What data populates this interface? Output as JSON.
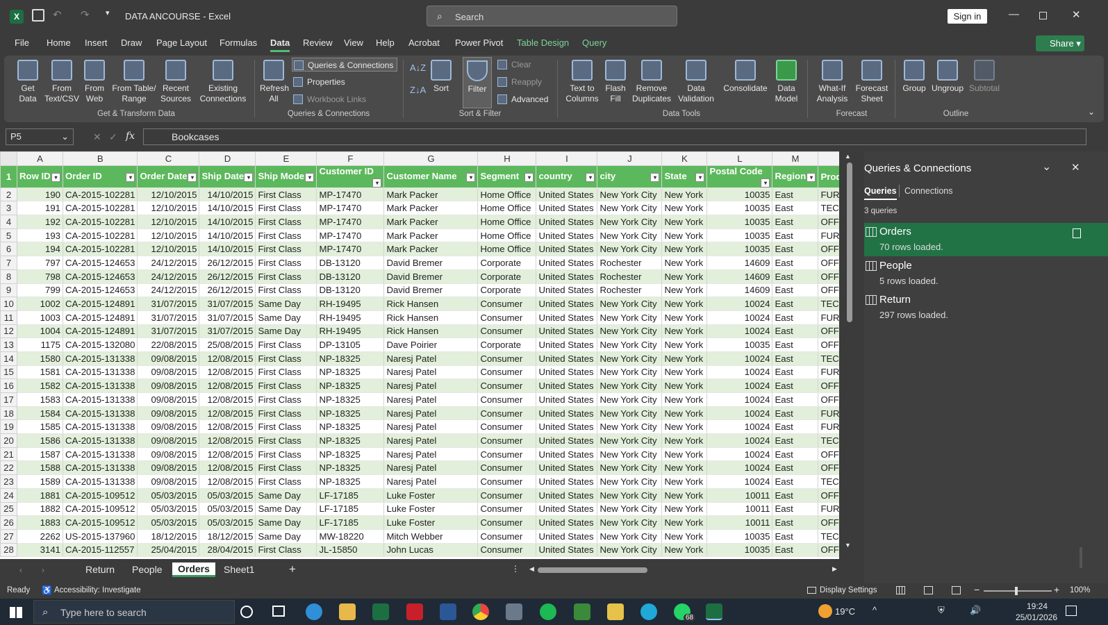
{
  "app": {
    "file_title": "DATA ANCOURSE",
    "app_name": "Excel",
    "search_placeholder": "Search",
    "sign_in": "Sign in",
    "share": "Share"
  },
  "tabs": [
    "File",
    "Home",
    "Insert",
    "Draw",
    "Page Layout",
    "Formulas",
    "Data",
    "Review",
    "View",
    "Help",
    "Acrobat",
    "Power Pivot",
    "Table Design",
    "Query"
  ],
  "ribbon": {
    "get_data": "Get Data",
    "from_text": "From Text/CSV",
    "from_web": "From Web",
    "from_table": "From Table/ Range",
    "recent_sources": "Recent Sources",
    "existing_connections": "Existing Connections",
    "group_get": "Get & Transform Data",
    "refresh_all": "Refresh All",
    "queries_connections": "Queries & Connections",
    "properties": "Properties",
    "workbook_links": "Workbook Links",
    "group_queries": "Queries & Connections",
    "sort": "Sort",
    "filter": "Filter",
    "clear": "Clear",
    "reapply": "Reapply",
    "advanced": "Advanced",
    "group_sort": "Sort & Filter",
    "text_to_columns": "Text to Columns",
    "flash_fill": "Flash Fill",
    "remove_duplicates": "Remove Duplicates",
    "data_validation": "Data Validation",
    "consolidate": "Consolidate",
    "data_model": "Data Model",
    "group_tools": "Data Tools",
    "what_if": "What-If Analysis",
    "forecast_sheet": "Forecast Sheet",
    "group_forecast": "Forecast",
    "group": "Group",
    "ungroup": "Ungroup",
    "subtotal": "Subtotal",
    "group_outline": "Outline"
  },
  "formula": {
    "name_box": "P5",
    "fx": "fx",
    "value": "Bookcases"
  },
  "columns": [
    "A",
    "B",
    "C",
    "D",
    "E",
    "F",
    "G",
    "H",
    "I",
    "J",
    "K",
    "L",
    "M"
  ],
  "headers": [
    "Row ID",
    "Order ID",
    "Order Date",
    "Ship Date",
    "Ship Mode",
    "Customer ID",
    "Customer Name",
    "Segment",
    "country",
    "city",
    "State",
    "Postal Code",
    "Region",
    "Produ"
  ],
  "rows": [
    [
      "190",
      "CA-2015-102281",
      "12/10/2015",
      "14/10/2015",
      "First Class",
      "MP-17470",
      "Mark Packer",
      "Home Office",
      "United States",
      "New York City",
      "New York",
      "10035",
      "East",
      "FUR-B"
    ],
    [
      "191",
      "CA-2015-102281",
      "12/10/2015",
      "14/10/2015",
      "First Class",
      "MP-17470",
      "Mark Packer",
      "Home Office",
      "United States",
      "New York City",
      "New York",
      "10035",
      "East",
      "TEC-P"
    ],
    [
      "192",
      "CA-2015-102281",
      "12/10/2015",
      "14/10/2015",
      "First Class",
      "MP-17470",
      "Mark Packer",
      "Home Office",
      "United States",
      "New York City",
      "New York",
      "10035",
      "East",
      "OFF-P"
    ],
    [
      "193",
      "CA-2015-102281",
      "12/10/2015",
      "14/10/2015",
      "First Class",
      "MP-17470",
      "Mark Packer",
      "Home Office",
      "United States",
      "New York City",
      "New York",
      "10035",
      "East",
      "FUR-B"
    ],
    [
      "194",
      "CA-2015-102281",
      "12/10/2015",
      "14/10/2015",
      "First Class",
      "MP-17470",
      "Mark Packer",
      "Home Office",
      "United States",
      "New York City",
      "New York",
      "10035",
      "East",
      "OFF-A"
    ],
    [
      "797",
      "CA-2015-124653",
      "24/12/2015",
      "26/12/2015",
      "First Class",
      "DB-13120",
      "David Bremer",
      "Corporate",
      "United States",
      "Rochester",
      "New York",
      "14609",
      "East",
      "OFF-P"
    ],
    [
      "798",
      "CA-2015-124653",
      "24/12/2015",
      "26/12/2015",
      "First Class",
      "DB-13120",
      "David Bremer",
      "Corporate",
      "United States",
      "Rochester",
      "New York",
      "14609",
      "East",
      "OFF-P"
    ],
    [
      "799",
      "CA-2015-124653",
      "24/12/2015",
      "26/12/2015",
      "First Class",
      "DB-13120",
      "David Bremer",
      "Corporate",
      "United States",
      "Rochester",
      "New York",
      "14609",
      "East",
      "OFF-L"
    ],
    [
      "1002",
      "CA-2015-124891",
      "31/07/2015",
      "31/07/2015",
      "Same Day",
      "RH-19495",
      "Rick Hansen",
      "Consumer",
      "United States",
      "New York City",
      "New York",
      "10024",
      "East",
      "TEC-A"
    ],
    [
      "1003",
      "CA-2015-124891",
      "31/07/2015",
      "31/07/2015",
      "Same Day",
      "RH-19495",
      "Rick Hansen",
      "Consumer",
      "United States",
      "New York City",
      "New York",
      "10024",
      "East",
      "FUR-T"
    ],
    [
      "1004",
      "CA-2015-124891",
      "31/07/2015",
      "31/07/2015",
      "Same Day",
      "RH-19495",
      "Rick Hansen",
      "Consumer",
      "United States",
      "New York City",
      "New York",
      "10024",
      "East",
      "OFF-P"
    ],
    [
      "1175",
      "CA-2015-132080",
      "22/08/2015",
      "25/08/2015",
      "First Class",
      "DP-13105",
      "Dave Poirier",
      "Corporate",
      "United States",
      "New York City",
      "New York",
      "10035",
      "East",
      "OFF-E"
    ],
    [
      "1580",
      "CA-2015-131338",
      "09/08/2015",
      "12/08/2015",
      "First Class",
      "NP-18325",
      "Naresj Patel",
      "Consumer",
      "United States",
      "New York City",
      "New York",
      "10024",
      "East",
      "TEC-P"
    ],
    [
      "1581",
      "CA-2015-131338",
      "09/08/2015",
      "12/08/2015",
      "First Class",
      "NP-18325",
      "Naresj Patel",
      "Consumer",
      "United States",
      "New York City",
      "New York",
      "10024",
      "East",
      "FUR-T"
    ],
    [
      "1582",
      "CA-2015-131338",
      "09/08/2015",
      "12/08/2015",
      "First Class",
      "NP-18325",
      "Naresj Patel",
      "Consumer",
      "United States",
      "New York City",
      "New York",
      "10024",
      "East",
      "OFF-S"
    ],
    [
      "1583",
      "CA-2015-131338",
      "09/08/2015",
      "12/08/2015",
      "First Class",
      "NP-18325",
      "Naresj Patel",
      "Consumer",
      "United States",
      "New York City",
      "New York",
      "10024",
      "East",
      "OFF-B"
    ],
    [
      "1584",
      "CA-2015-131338",
      "09/08/2015",
      "12/08/2015",
      "First Class",
      "NP-18325",
      "Naresj Patel",
      "Consumer",
      "United States",
      "New York City",
      "New York",
      "10024",
      "East",
      "FUR-F"
    ],
    [
      "1585",
      "CA-2015-131338",
      "09/08/2015",
      "12/08/2015",
      "First Class",
      "NP-18325",
      "Naresj Patel",
      "Consumer",
      "United States",
      "New York City",
      "New York",
      "10024",
      "East",
      "FUR-F"
    ],
    [
      "1586",
      "CA-2015-131338",
      "09/08/2015",
      "12/08/2015",
      "First Class",
      "NP-18325",
      "Naresj Patel",
      "Consumer",
      "United States",
      "New York City",
      "New York",
      "10024",
      "East",
      "TEC-P"
    ],
    [
      "1587",
      "CA-2015-131338",
      "09/08/2015",
      "12/08/2015",
      "First Class",
      "NP-18325",
      "Naresj Patel",
      "Consumer",
      "United States",
      "New York City",
      "New York",
      "10024",
      "East",
      "OFF-P"
    ],
    [
      "1588",
      "CA-2015-131338",
      "09/08/2015",
      "12/08/2015",
      "First Class",
      "NP-18325",
      "Naresj Patel",
      "Consumer",
      "United States",
      "New York City",
      "New York",
      "10024",
      "East",
      "OFF-P"
    ],
    [
      "1589",
      "CA-2015-131338",
      "09/08/2015",
      "12/08/2015",
      "First Class",
      "NP-18325",
      "Naresj Patel",
      "Consumer",
      "United States",
      "New York City",
      "New York",
      "10024",
      "East",
      "TEC-A"
    ],
    [
      "1881",
      "CA-2015-109512",
      "05/03/2015",
      "05/03/2015",
      "Same Day",
      "LF-17185",
      "Luke Foster",
      "Consumer",
      "United States",
      "New York City",
      "New York",
      "10011",
      "East",
      "OFF-B"
    ],
    [
      "1882",
      "CA-2015-109512",
      "05/03/2015",
      "05/03/2015",
      "Same Day",
      "LF-17185",
      "Luke Foster",
      "Consumer",
      "United States",
      "New York City",
      "New York",
      "10011",
      "East",
      "FUR-C"
    ],
    [
      "1883",
      "CA-2015-109512",
      "05/03/2015",
      "05/03/2015",
      "Same Day",
      "LF-17185",
      "Luke Foster",
      "Consumer",
      "United States",
      "New York City",
      "New York",
      "10011",
      "East",
      "OFF-S"
    ],
    [
      "2262",
      "US-2015-137960",
      "18/12/2015",
      "18/12/2015",
      "Same Day",
      "MW-18220",
      "Mitch Webber",
      "Consumer",
      "United States",
      "New York City",
      "New York",
      "10035",
      "East",
      "TEC-A"
    ],
    [
      "3141",
      "CA-2015-112557",
      "25/04/2015",
      "28/04/2015",
      "First Class",
      "JL-15850",
      "John Lucas",
      "Consumer",
      "United States",
      "New York City",
      "New York",
      "10035",
      "East",
      "OFF-A"
    ]
  ],
  "queries": {
    "title": "Queries & Connections",
    "tab_queries": "Queries",
    "tab_connections": "Connections",
    "count": "3 queries",
    "items": [
      {
        "name": "Orders",
        "sub": "70 rows loaded."
      },
      {
        "name": "People",
        "sub": "5 rows loaded."
      },
      {
        "name": "Return",
        "sub": "297 rows loaded."
      }
    ]
  },
  "sheets": [
    "Return",
    "People",
    "Orders",
    "Sheet1"
  ],
  "status": {
    "ready": "Ready",
    "accessibility": "Accessibility: Investigate",
    "display_settings": "Display Settings",
    "zoom": "100%"
  },
  "taskbar": {
    "search": "Type here to search",
    "temp": "19°C",
    "time": "19:24",
    "date": "25/01/2026",
    "badge": "68"
  }
}
